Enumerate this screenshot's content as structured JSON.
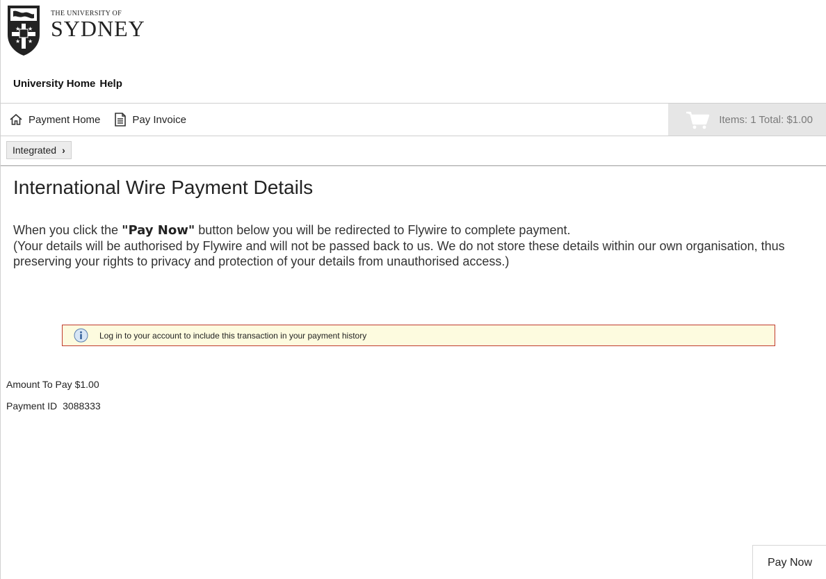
{
  "brand": {
    "line1": "THE UNIVERSITY OF",
    "line2": "SYDNEY"
  },
  "topnav": {
    "items": [
      {
        "label": "University Home"
      },
      {
        "label": "Help"
      }
    ]
  },
  "subnav": {
    "items": [
      {
        "label": "Payment Home",
        "icon": "home-icon"
      },
      {
        "label": "Pay Invoice",
        "icon": "document-icon"
      }
    ],
    "cart": {
      "icon": "cart-icon",
      "summary": "Items: 1 Total: $1.00"
    }
  },
  "breadcrumb": {
    "label": "Integrated",
    "chevron": "›"
  },
  "main": {
    "title": "International Wire Payment Details",
    "intro_pre": "When you click the ",
    "intro_bold": "\"Pay Now\"",
    "intro_post": " button below you will be redirected to Flywire to complete payment.",
    "intro_line2": "(Your details will be authorised by Flywire and will not be passed back to us. We do not store these details within our own organisation, thus preserving your rights to privacy and protection of your details from unauthorised access.)",
    "notice": {
      "icon": "info-icon",
      "text": "Log in to your account to include this transaction in your payment history"
    },
    "amount_text": "Amount To Pay $1.00",
    "payment_id_label": "Payment ID",
    "payment_id_value": "3088333",
    "pay_now_label": "Pay Now"
  },
  "colors": {
    "notice_border": "#c03a2b",
    "notice_bg": "#fdfbdf",
    "cart_bg": "#e6e6e6"
  }
}
